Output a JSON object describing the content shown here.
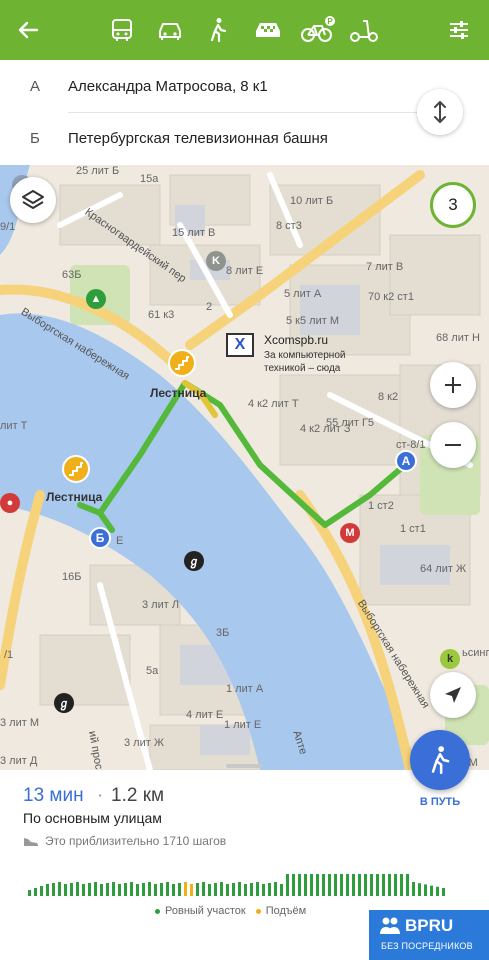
{
  "topbar": {
    "back_icon": "arrow-left-icon",
    "modes": [
      "bus-icon",
      "car-icon",
      "walk-icon",
      "taxi-icon",
      "bike-icon",
      "scooter-icon"
    ],
    "filter_icon": "sliders-icon",
    "color": "#6eb432"
  },
  "route": {
    "from_letter": "А",
    "from_address": "Александра Матросова, 8 к1",
    "to_letter": "Б",
    "to_address": "Петербургская телевизионная башня"
  },
  "map": {
    "alternatives_count": "3",
    "marker_a": "А",
    "marker_b": "Б",
    "stairs_label_1": "Лестница",
    "stairs_label_2": "Лестница",
    "ad": {
      "logo": "X",
      "title": "Xcomspb.ru",
      "line1": "За компьютерной",
      "line2": "техникой – сюда"
    },
    "streets": {
      "s1": "Красногвардейский пер",
      "s2": "Выборгская набережная",
      "s3": "Выборгская набережная",
      "s4": "ий проспект",
      "s5": "Апте"
    },
    "labels": {
      "l1": "15а",
      "l2": "10 лит Б",
      "l3": "15 лит В",
      "l4": "8 ст3",
      "l5": "8 лит Е",
      "l6": "7 лит В",
      "l7": "63Б",
      "l8": "5 лит А",
      "l9": "70 к2 ст1",
      "l10": "61 к3",
      "l11": "2",
      "l12": "5 к5 лит М",
      "l13": "68 лит Н",
      "l14": "8 к2",
      "l15": "4 к2 лит Т",
      "l16": "55 лит Г5",
      "l17": "4 к2 лит З",
      "l18": "ст-8/1",
      "l19": "2",
      "l20": "1 ст1",
      "l21": "64 лит Ж",
      "l22": "16Б",
      "l23": "3 лит Л",
      "l24": "3Б",
      "l25": "5а",
      "l26": "1 лит А",
      "l27": "1 лит Е",
      "l28": "3 лит Ж",
      "l29": "3 лит М",
      "l30": "4 лит Е",
      "l31": "лит Т",
      "l32": "3 лит Д",
      "l33": "/1",
      "l34": "9/1",
      "l35": "лит М",
      "l36": "ьсинг",
      "l37": "25 лит Б",
      "l38": "Е",
      "l39": "лит",
      "l40": "1 ст2"
    }
  },
  "sheet": {
    "time": "13 мин",
    "separator": "·",
    "distance": "1.2 км",
    "via": "По основным улицам",
    "steps": "Это приблизительно 1710 шагов",
    "go_label": "В ПУТЬ",
    "legend_flat": "Ровный участок",
    "legend_up": "Подъём",
    "flat_color": "#2e9e3c",
    "up_color": "#f1b01a"
  },
  "brand": {
    "name": "BPRU",
    "tagline": "БЕЗ ПОСРЕДНИКОВ"
  }
}
